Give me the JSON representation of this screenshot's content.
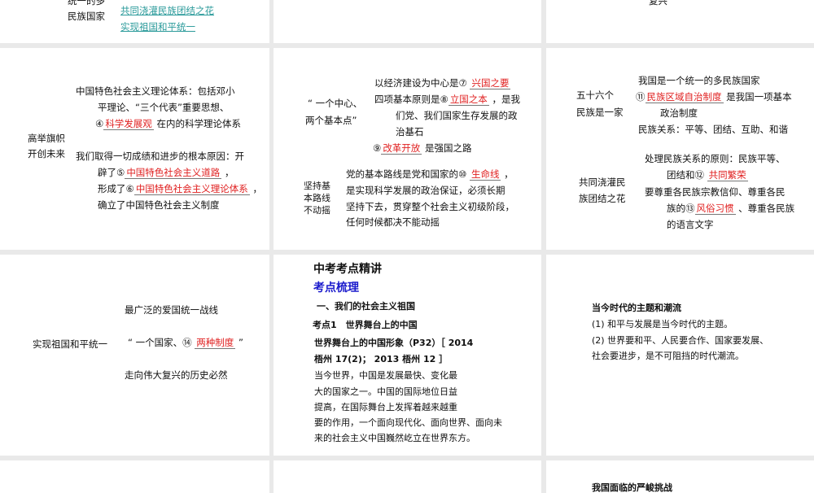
{
  "row1": {
    "left_label1": "统一的多",
    "left_label2": "民族国家",
    "link1": "共同浇灌民族团结之花",
    "link2": "实现祖国和平统一",
    "right_fragment": "复兴"
  },
  "p_left": {
    "label1": "高举旗帜",
    "label2": "开创未来",
    "l1": "中国特色社会主义理论体系：包括邓小",
    "l2": "平理论、“三个代表”重要思想、",
    "l3a": "④",
    "l3b": "科学发展观",
    "l3c": "在内的科学理论体系",
    "l4": "我们取得一切成绩和进步的根本原因：开",
    "l5a": "辟了⑤",
    "l5b": "中国特色社会主义道路",
    "l5c": "，",
    "l6a": "形成了⑥",
    "l6b": "中国特色社会主义理论体系",
    "l6c": "，",
    "l7": "确立了中国特色社会主义制度"
  },
  "p_mid": {
    "label1": "“ 一个中心、",
    "label2": "两个基本点”",
    "l1a": "以经济建设为中心是⑦",
    "l1b": "兴国之要",
    "l2a": "四项基本原则是⑧",
    "l2b": "立国之本",
    "l2c": "，是我",
    "l3": "们党、我们国家生存发展的政",
    "l4": "治基石",
    "l5a": "⑨",
    "l5b": "改革开放",
    "l5c": "是强国之路",
    "label3": "坚持基",
    "label4": "本路线",
    "label5": "不动摇",
    "l6a": "党的基本路线是党和国家的⑩",
    "l6b": "生命线",
    "l6c": "，",
    "l7": "是实现科学发展的政治保证，必须长期",
    "l8": "坚持下去，贯穿整个社会主义初级阶段，",
    "l9": "任何时候都决不能动摇"
  },
  "p_right": {
    "label1": "五十六个",
    "label2": "民族是一家",
    "l1": "我国是一个统一的多民族国家",
    "l2a": "⑪",
    "l2b": "民族区域自治制度",
    "l2c": "是我国一项基本",
    "l3": "政治制度",
    "l4": "民族关系：平等、团结、互助、和谐",
    "label3": "共同浇灌民",
    "label4": "族团结之花",
    "l5": "处理民族关系的原则：民族平等、",
    "l6a": "团结和⑫",
    "l6b": "共同繁荣",
    "l7": "要尊重各民族宗教信仰、尊重各民",
    "l8a": "族的⑬",
    "l8b": "风俗习惯",
    "l8c": "、尊重各民族",
    "l9": "的语言文字"
  },
  "p3_left": {
    "label": "实现祖国和平统一",
    "l1": "最广泛的爱国统一战线",
    "l2a": "“ 一个国家、⑭",
    "l2b": "两种制度",
    "l2c": "”",
    "l3": "走向伟大复兴的历史必然"
  },
  "p3_mid": {
    "title": "中考考点精讲",
    "subtitle": "考点梳理",
    "section": "一、我们的社会主义祖国",
    "point": "考点1　世界舞台上的中国",
    "h": "世界舞台上的中国形象（P32）［ 2014",
    "h2": "梧州 17(2)； 2013 梧州 12 ］",
    "b1": "当今世界，中国是发展最快、变化最",
    "b2": "大的国家之一。中国的国际地位日益",
    "b3": "提高，在国际舞台上发挥着越来越重",
    "b4": "要的作用，一个面向现代化、面向世界、面向未",
    "b5": "来的社会主义中国巍然屹立在世界东方。"
  },
  "p3_right": {
    "title": "当今时代的主题和潮流",
    "l1": "(1) 和平与发展是当今时代的主题。",
    "l2": "(2) 世界要和平、人民要合作、国家要发展、",
    "l3": "社会要进步，是不可阻挡的时代潮流。"
  },
  "row4": {
    "right_fragment": "我国面临的严峻挑战"
  },
  "colors": {
    "blank": "#e02020",
    "link": "#2a9a9a",
    "subtitle": "#1a1acc",
    "gap": "#e9e9e9"
  }
}
